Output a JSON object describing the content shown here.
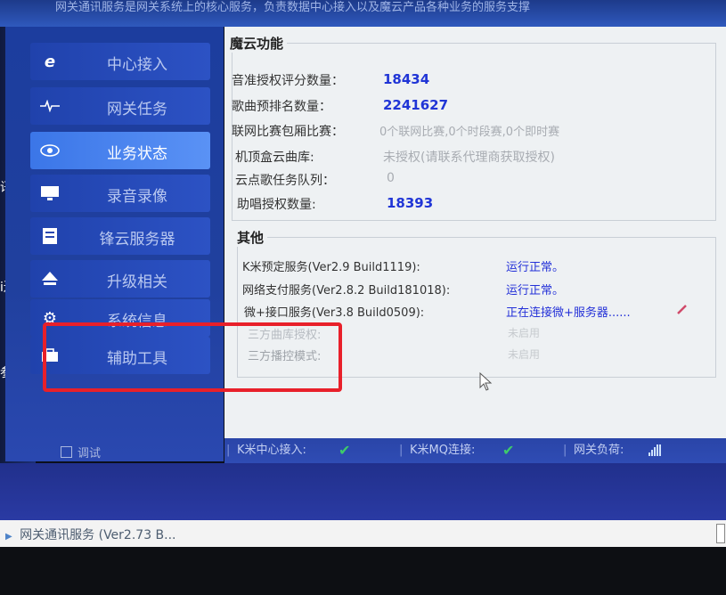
{
  "top_banner": {
    "text": "网关通讯服务是网关系统上的核心服务，负责数据中心接入以及魔云产品各种业务的服务支撑"
  },
  "desktop_labels": {
    "left1": "讯",
    "left2": "i连",
    "left3": "参数i"
  },
  "sidebar": {
    "items": [
      {
        "label": "中心接入",
        "icon": "ie-icon"
      },
      {
        "label": "网关任务",
        "icon": "pulse-icon"
      },
      {
        "label": "业务状态",
        "icon": "eye-icon"
      },
      {
        "label": "录音录像",
        "icon": "monitor-icon"
      },
      {
        "label": "锋云服务器",
        "icon": "server-icon"
      },
      {
        "label": "升级相关",
        "icon": "upload-icon"
      },
      {
        "label": "系统信息",
        "icon": "gear-icon"
      },
      {
        "label": "辅助工具",
        "icon": "toolbox-icon"
      }
    ],
    "active_index": 2,
    "debug_label": "调试"
  },
  "moyun": {
    "title": "魔云功能",
    "rows": [
      {
        "label": "音准授权评分数量：",
        "value": "18434"
      },
      {
        "label": "歌曲预排名数量：",
        "value": "2241627"
      },
      {
        "label": "联网比赛包厢比赛：",
        "value": "0个联网比赛,0个时段赛,0个即时赛"
      },
      {
        "label": "机顶盒云曲库:",
        "value": "未授权(请联系代理商获取授权)"
      },
      {
        "label": "云点歌任务队列：",
        "value": "0"
      },
      {
        "label": "助唱授权数量:",
        "value": "18393"
      }
    ]
  },
  "other": {
    "title": "其他",
    "rows": [
      {
        "label": "K米预定服务(Ver2.9 Build1119):",
        "value": "运行正常。"
      },
      {
        "label": "网络支付服务(Ver2.8.2 Build181018):",
        "value": "运行正常。"
      },
      {
        "label": "微+接口服务(Ver3.8 Build0509):",
        "value": "正在连接微+服务器......"
      },
      {
        "label": "三方曲库授权:",
        "value": "未启用"
      },
      {
        "label": "三方播控模式:",
        "value": "未启用"
      }
    ]
  },
  "statusbar": {
    "center_label": "K米中心接入:",
    "mq_label": "K米MQ连接:",
    "load_label": "网关负荷:",
    "check_symbol": "✔"
  },
  "taskbar": {
    "item_label": "网关通讯服务 (Ver2.73 B..."
  },
  "colors": {
    "accent_blue": "#2035d6",
    "highlight_red": "#e8202a",
    "check_green": "#3ecb6a"
  }
}
